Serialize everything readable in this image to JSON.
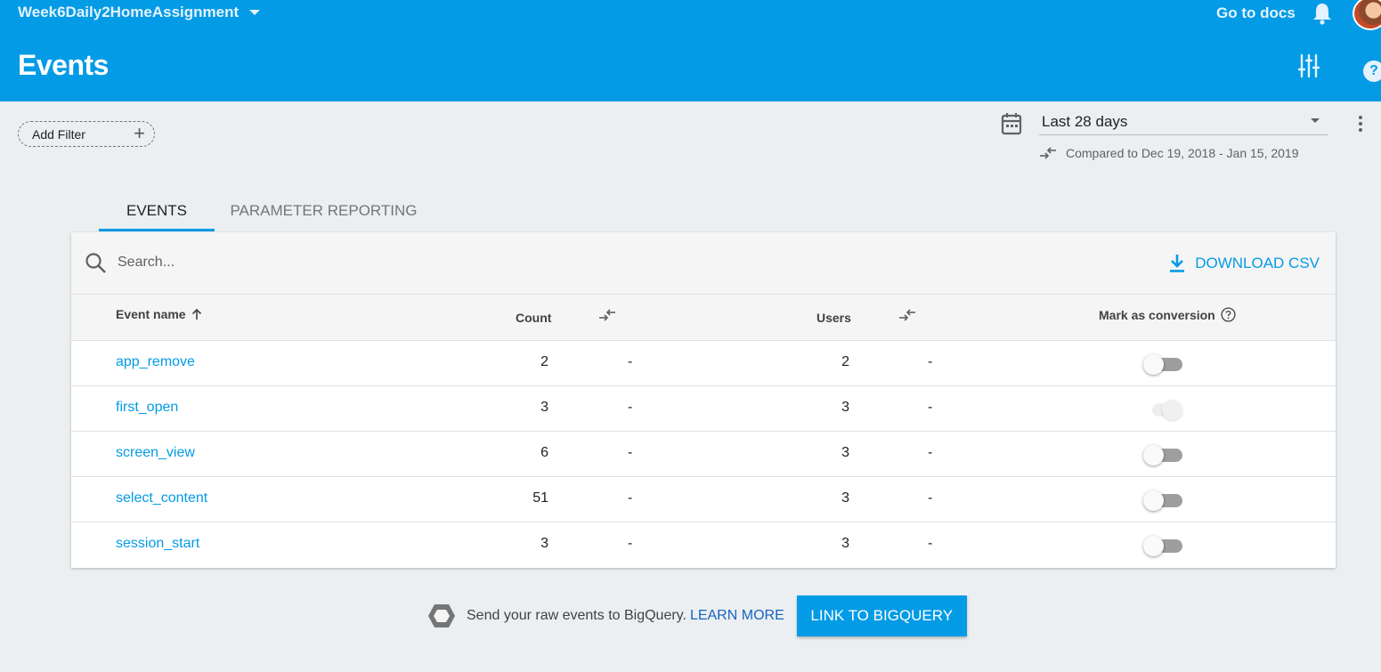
{
  "header": {
    "project_name": "Week6Daily2HomeAssignment",
    "title": "Events",
    "docs_label": "Go to docs",
    "help_glyph": "?"
  },
  "filter": {
    "add_label": "Add Filter",
    "plus_glyph": "+"
  },
  "date_range": {
    "selected": "Last 28 days",
    "compared": "Compared to Dec 19, 2018 - Jan 15, 2019"
  },
  "tabs": [
    {
      "label": "EVENTS",
      "active": true
    },
    {
      "label": "PARAMETER REPORTING",
      "active": false
    }
  ],
  "table": {
    "search_placeholder": "Search...",
    "download_label": "DOWNLOAD CSV",
    "columns": {
      "event_name": "Event name",
      "count": "Count",
      "users": "Users",
      "conversion": "Mark as conversion"
    },
    "rows": [
      {
        "name": "app_remove",
        "count": "2",
        "count_change": "-",
        "users": "2",
        "users_change": "-",
        "conversion": "off"
      },
      {
        "name": "first_open",
        "count": "3",
        "count_change": "-",
        "users": "3",
        "users_change": "-",
        "conversion": "on (disabled)"
      },
      {
        "name": "screen_view",
        "count": "6",
        "count_change": "-",
        "users": "3",
        "users_change": "-",
        "conversion": "off"
      },
      {
        "name": "select_content",
        "count": "51",
        "count_change": "-",
        "users": "3",
        "users_change": "-",
        "conversion": "off"
      },
      {
        "name": "session_start",
        "count": "3",
        "count_change": "-",
        "users": "3",
        "users_change": "-",
        "conversion": "off"
      }
    ]
  },
  "footer": {
    "text": "Send your raw events to BigQuery.",
    "learn_more": "LEARN MORE",
    "button_label": "LINK TO BIGQUERY"
  },
  "colors": {
    "header_blue": "#039be5",
    "link_blue": "#039be5",
    "background": "#eceff1"
  },
  "icons": [
    "chevron-down-icon",
    "bell-icon",
    "avatar",
    "tune-icon",
    "help-icon",
    "calendar-icon",
    "compare-icon",
    "more-vert-icon",
    "search-icon",
    "download-icon",
    "arrow-up-icon",
    "bigquery-icon"
  ]
}
